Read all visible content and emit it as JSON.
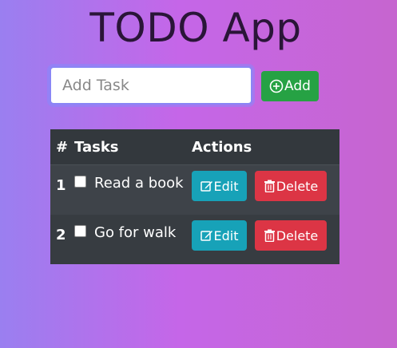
{
  "app": {
    "title": "TODO App"
  },
  "input": {
    "placeholder": "Add Task",
    "value": ""
  },
  "add_button": {
    "label": "Add",
    "icon": "plus-circle-icon"
  },
  "table": {
    "headers": [
      "#",
      "Tasks",
      "Actions"
    ],
    "rows": [
      {
        "num": "1",
        "task": "Read a book",
        "checked": false,
        "edit_label": "Edit",
        "delete_label": "Delete"
      },
      {
        "num": "2",
        "task": "Go for walk",
        "checked": false,
        "edit_label": "Edit",
        "delete_label": "Delete"
      }
    ]
  },
  "colors": {
    "add": "#26a244",
    "edit": "#17a2b8",
    "delete": "#dc3545",
    "table_bg": "#3a3f44"
  }
}
